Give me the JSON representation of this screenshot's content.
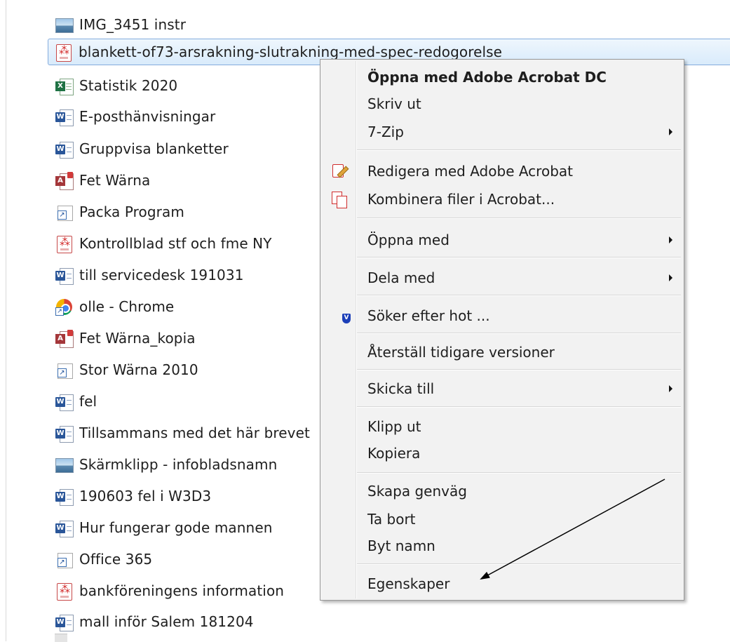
{
  "file_list": [
    {
      "name": "IMG_3451 instr",
      "icon": "image-file-icon"
    },
    {
      "name": "blankett-of73-arsrakning-slutrakning-med-spec-redogorelse",
      "icon": "pdf-file-icon",
      "selected": true
    },
    {
      "name": "Statistik 2020",
      "icon": "excel-file-icon"
    },
    {
      "name": "E-posthänvisningar",
      "icon": "word-file-icon"
    },
    {
      "name": "Gruppvisa blanketter",
      "icon": "word-file-icon"
    },
    {
      "name": "Fet Wärna",
      "icon": "access-file-icon"
    },
    {
      "name": "Packa Program",
      "icon": "shortcut-icon"
    },
    {
      "name": "Kontrollblad stf och fme NY",
      "icon": "pdf-file-icon"
    },
    {
      "name": "till servicedesk 191031",
      "icon": "word-file-icon"
    },
    {
      "name": "olle - Chrome",
      "icon": "chrome-shortcut-icon"
    },
    {
      "name": "Fet Wärna_kopia",
      "icon": "access-file-icon"
    },
    {
      "name": "Stor Wärna 2010",
      "icon": "shortcut-icon"
    },
    {
      "name": "fel",
      "icon": "word-file-icon"
    },
    {
      "name": "Tillsammans med det här brevet",
      "icon": "word-file-icon"
    },
    {
      "name": "Skärmklipp - infobladsnamn",
      "icon": "image-file-icon"
    },
    {
      "name": "190603 fel i W3D3",
      "icon": "word-file-icon"
    },
    {
      "name": "Hur fungerar gode mannen",
      "icon": "word-file-icon"
    },
    {
      "name": "Office 365",
      "icon": "shortcut-icon"
    },
    {
      "name": "bankföreningens information",
      "icon": "pdf-file-icon"
    },
    {
      "name": "mall inför Salem 181204",
      "icon": "word-file-icon"
    }
  ],
  "context_menu": {
    "items": [
      {
        "label": "Öppna med Adobe Acrobat DC",
        "bold": true
      },
      {
        "label": "Skriv ut"
      },
      {
        "label": "7-Zip",
        "submenu": true
      },
      {
        "label": "Redigera med Adobe Acrobat",
        "icon": "acrobat-edit-icon"
      },
      {
        "label": "Kombinera filer i Acrobat...",
        "icon": "acrobat-combine-icon"
      },
      {
        "label": "Öppna med",
        "submenu": true
      },
      {
        "label": "Dela med",
        "submenu": true
      },
      {
        "label": "Söker efter hot ...",
        "icon": "security-shield-icon"
      },
      {
        "label": "Återställ tidigare versioner"
      },
      {
        "label": "Skicka till",
        "submenu": true
      },
      {
        "label": "Klipp ut"
      },
      {
        "label": "Kopiera"
      },
      {
        "label": "Skapa genväg"
      },
      {
        "label": "Ta bort"
      },
      {
        "label": "Byt namn"
      },
      {
        "label": "Egenskaper"
      }
    ]
  },
  "colors": {
    "selection_border": "#84acdd",
    "menu_background": "#f2f2f2",
    "word_blue": "#2a5699",
    "excel_green": "#1f7244",
    "access_red": "#a4373a",
    "acrobat_red": "#d02d2d"
  }
}
